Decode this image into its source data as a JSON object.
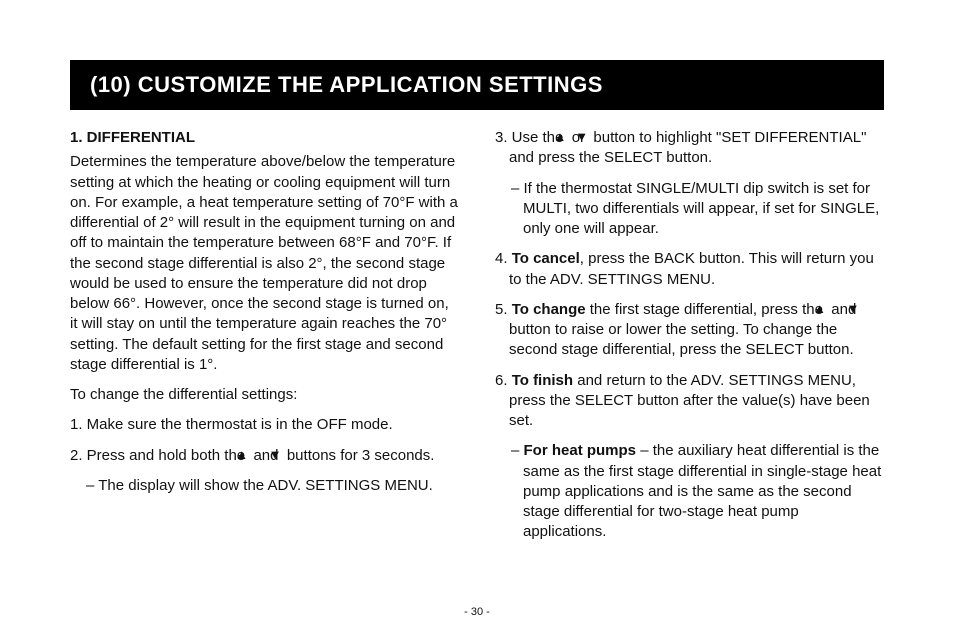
{
  "section_title": "(10) CUSTOMIZE THE APPLICATION SETTINGS",
  "left": {
    "heading": "1. DIFFERENTIAL",
    "para1": "Determines the temperature above/below the temperature setting at which the heating or cooling equipment will turn on. For example, a heat temperature setting of 70°F with a differential of 2° will result in the equipment turning on and off to maintain the temperature between 68°F and 70°F. If the second stage differential is also 2°, the second stage would be used to ensure the temperature did not drop below 66°. However, once the second stage is turned on, it will stay on until the temperature again reaches the 70° setting. The default setting for the first stage and second stage differential is 1°.",
    "para2": "To change the differential settings:",
    "step1": "1. Make sure the thermostat is in the OFF mode.",
    "step2_pre": "2. Press and hold both the ",
    "step2_mid": " and ",
    "step2_post": " buttons for 3 seconds.",
    "step2_sub": "– The display will show the ADV. SETTINGS MENU."
  },
  "right": {
    "step3_pre": "3. Use the ",
    "step3_mid": " or ",
    "step3_post": " button to highlight \"SET DIFFERENTIAL\" and press the SELECT button.",
    "step3_sub": "– If the thermostat SINGLE/MULTI dip switch is set for MULTI, two differentials will appear, if set for SINGLE, only one will appear.",
    "step4_num": "4. ",
    "step4_bold": "To cancel",
    "step4_rest": ", press the BACK button. This will return you to the ADV. SETTINGS MENU.",
    "step5_num": "5. ",
    "step5_bold": "To change",
    "step5_mid1": " the first stage differential, press the ",
    "step5_mid2": " and ",
    "step5_post": " button to raise or lower the setting. To change the second stage differential, press the SELECT button.",
    "step6_num": "6. ",
    "step6_bold": "To finish",
    "step6_rest": " and return to the ADV. SETTINGS MENU, press the SELECT button after the value(s) have been set.",
    "step6_sub_dash": "– ",
    "step6_sub_bold": "For heat pumps",
    "step6_sub_rest": " – the auxiliary heat differential is the same as the first stage differential in single-stage heat pump applications and is the same as the second stage differential for two-stage heat pump applications."
  },
  "page_number": "- 30 -"
}
